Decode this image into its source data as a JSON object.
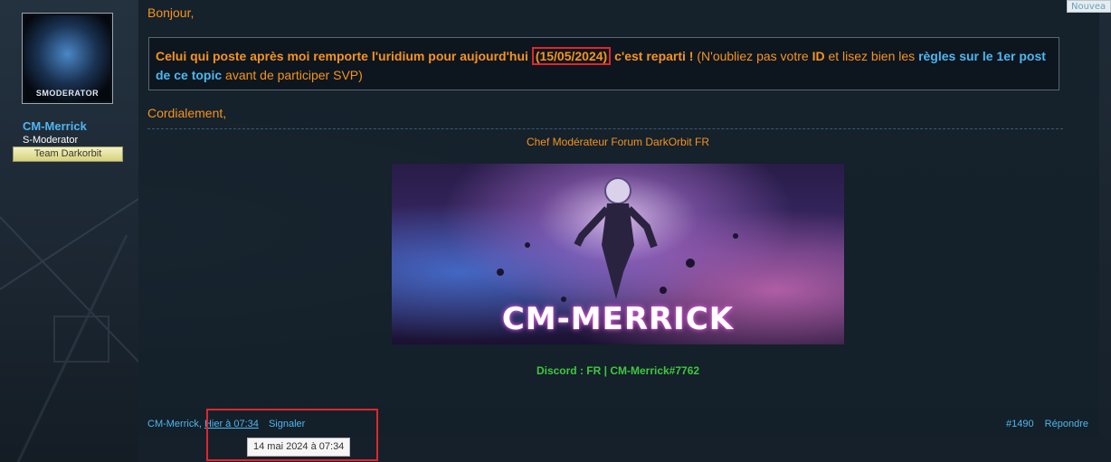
{
  "badge": {
    "new": "Nouvea"
  },
  "user": {
    "avatar_label": "SMODERATOR",
    "name": "CM-Merrick",
    "title": "S-Moderator",
    "banner": "Team Darkorbit"
  },
  "post": {
    "greeting": "Bonjour,",
    "quote": {
      "bold_intro": "Celui qui poste après moi remporte l'uridium pour aujourd'hui",
      "date": "(15/05/2024)",
      "bold_after_date": "c'est reparti !",
      "text_1": "(N'oubliez pas votre",
      "id_word": "ID",
      "text_2": "et lisez bien les",
      "rules_link": "règles sur le 1er post de ce topic",
      "text_3": "avant de participer SVP)"
    },
    "sign_off": "Cordialement,"
  },
  "signature": {
    "title": "Chef Modérateur Forum DarkOrbit FR",
    "banner_text": "CM-MERRICK",
    "discord": "Discord : FR | CM-Merrick#7762"
  },
  "footer": {
    "author": "CM-Merrick,",
    "time": "Hier à 07:34",
    "report": "Signaler",
    "tooltip": "14 mai 2024 à 07:34",
    "post_number": "#1490",
    "reply": "Répondre"
  },
  "colors": {
    "accent_orange": "#f7931e",
    "link_blue": "#4fb6f0",
    "highlight_red": "#e0262b",
    "discord_green": "#3ec83e"
  }
}
